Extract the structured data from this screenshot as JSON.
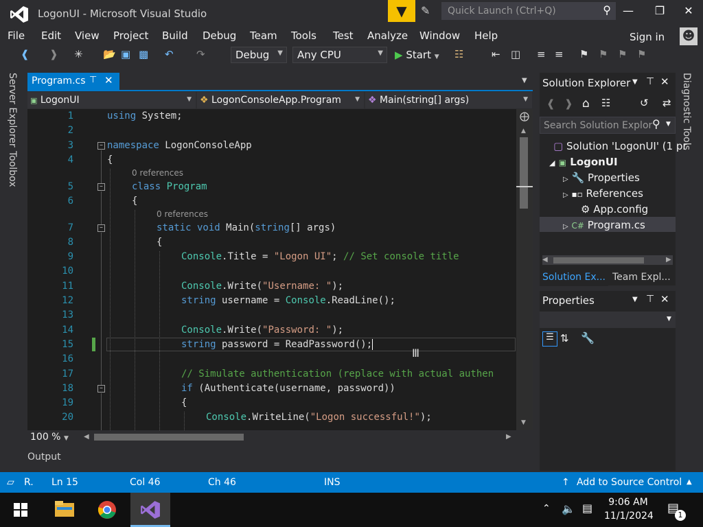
{
  "window": {
    "title": "LogonUI - Microsoft Visual Studio",
    "quick_launch_placeholder": "Quick Launch (Ctrl+Q)"
  },
  "menu": [
    "File",
    "Edit",
    "View",
    "Project",
    "Build",
    "Debug",
    "Team",
    "Tools",
    "Test",
    "Analyze",
    "Window",
    "Help"
  ],
  "account": {
    "sign_in": "Sign in"
  },
  "toolbar": {
    "config": "Debug",
    "platform": "Any CPU",
    "start": "Start"
  },
  "side_tabs": {
    "left": [
      "Server Explorer",
      "Toolbox"
    ],
    "right": "Diagnostic Tools"
  },
  "document_tab": {
    "label": "Program.cs"
  },
  "nav": {
    "project": "LogonUI",
    "class": "LogonConsoleApp.Program",
    "member": "Main(string[] args)"
  },
  "editor": {
    "line_numbers": [
      "1",
      "2",
      "3",
      "4",
      "5",
      "6",
      "7",
      "8",
      "9",
      "10",
      "11",
      "12",
      "13",
      "14",
      "15",
      "16",
      "17",
      "18",
      "19",
      "20"
    ],
    "references": [
      "0 references",
      "0 references"
    ],
    "lines": {
      "l1a": "using",
      "l1b": " System;",
      "l3a": "namespace",
      "l3b": " LogonConsoleApp",
      "l4": "{",
      "l5a": "class",
      "l5b": "Program",
      "l6": "{",
      "l7a": "static void",
      "l7b": " Main(",
      "l7c": "string",
      "l7d": "[] args)",
      "l8": "{",
      "l9a": "Console",
      "l9b": ".Title = ",
      "l9c": "\"Logon UI\"",
      "l9d": "; ",
      "l9e": "// Set console title",
      "l11a": "Console",
      "l11b": ".Write(",
      "l11c": "\"Username: \"",
      "l11d": ");",
      "l12a": "string",
      "l12b": " username = ",
      "l12c": "Console",
      "l12d": ".ReadLine();",
      "l14a": "Console",
      "l14b": ".Write(",
      "l14c": "\"Password: \"",
      "l14d": ");",
      "l15a": "string",
      "l15b": " password = ReadPassword();",
      "l17": "// Simulate authentication (replace with actual authen",
      "l18a": "if",
      "l18b": " (Authenticate(username, password))",
      "l19": "{",
      "l20a": "Console",
      "l20b": ".WriteLine(",
      "l20c": "\"Logon successful!\"",
      "l20d": ");"
    },
    "zoom": "100 %"
  },
  "output_tab": "Output",
  "solution_explorer": {
    "title": "Solution Explorer",
    "search_placeholder": "Search Solution Explor",
    "tree": {
      "solution": "Solution 'LogonUI' (1 pr",
      "project": "LogonUI",
      "properties": "Properties",
      "references": "References",
      "appconfig": "App.config",
      "program": "Program.cs"
    },
    "tabs": [
      "Solution Ex...",
      "Team Expl..."
    ]
  },
  "properties_panel": {
    "title": "Properties"
  },
  "status": {
    "ready": "R.",
    "ln": "Ln 15",
    "col": "Col 46",
    "ch": "Ch 46",
    "mode": "INS",
    "source_control": "Add to Source Control"
  },
  "taskbar": {
    "time": "9:06 AM",
    "date": "11/1/2024",
    "notifications": "1"
  },
  "colors": {
    "accent": "#007acc",
    "editor_bg": "#1e1e1e",
    "keyword": "#569cd6",
    "type": "#4ec9b0",
    "string": "#d69d85",
    "comment": "#57a64a",
    "line_number": "#2b91af"
  }
}
